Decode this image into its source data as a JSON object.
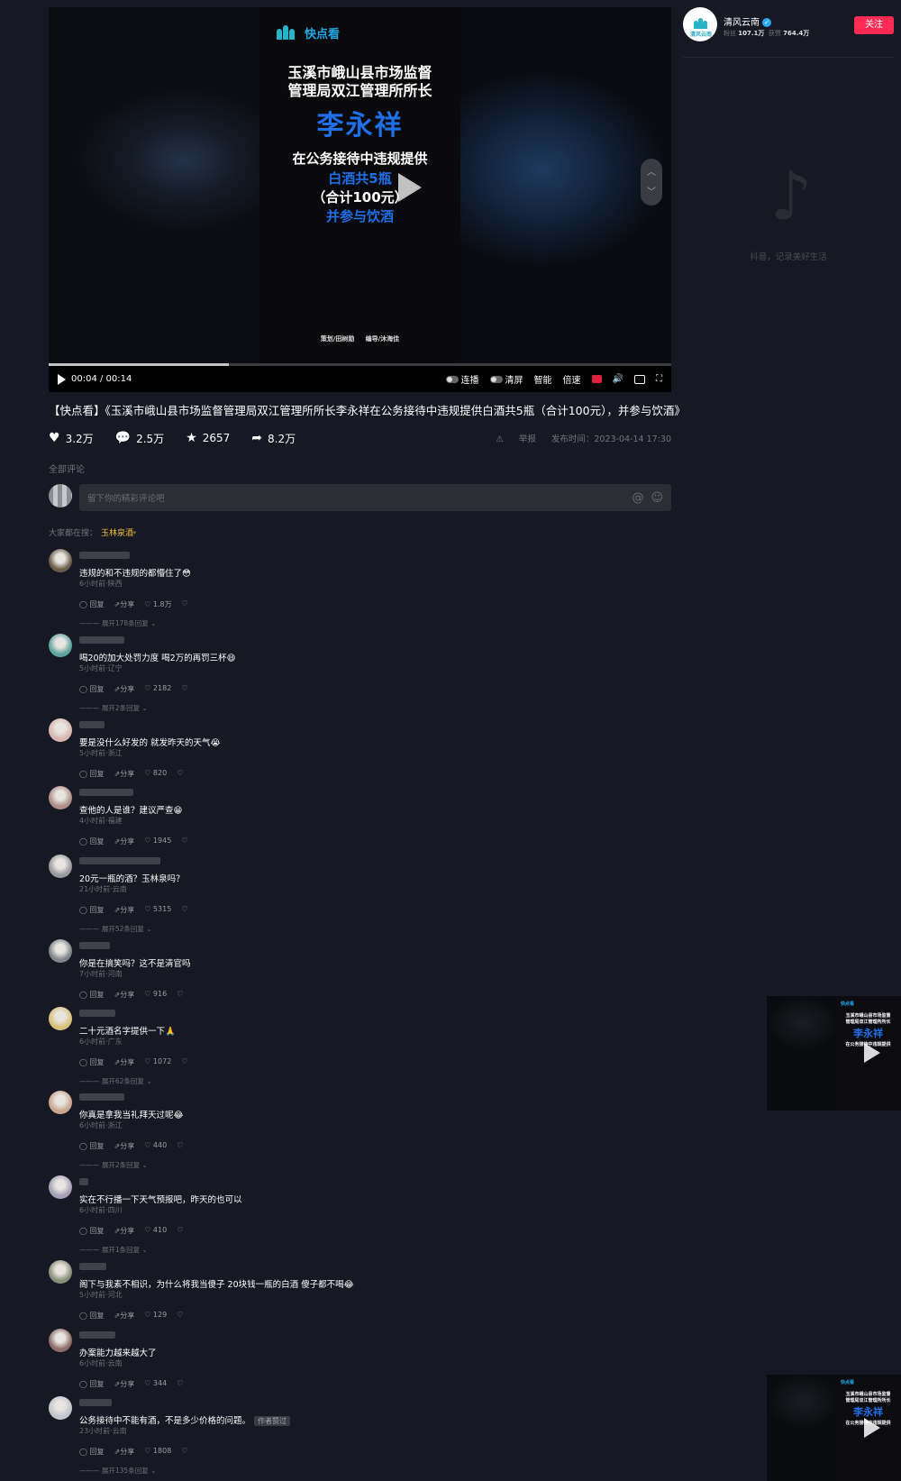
{
  "video": {
    "poster_brand_left": "清风云南",
    "poster_brand": "快点看",
    "poster_line1": "玉溪市峨山县市场监督",
    "poster_line2": "管理局双江管理所所长",
    "poster_name": "李永祥",
    "poster_line3": "在公务接待中违规提供",
    "poster_line4": "白酒共5瓶",
    "poster_line5": "（合计100元）",
    "poster_line6": "并参与饮酒",
    "poster_credit1": "策划/田树勋",
    "poster_credit2": "编导/沐海佳",
    "progress_fraction": 0.29,
    "time": "00:04 / 00:14",
    "ctl_autoplay": "连播",
    "ctl_clearscreen": "清屏",
    "ctl_smart": "智能",
    "ctl_speed": "倍速"
  },
  "title": "【快点看】《玉溪市峨山县市场监督管理局双江管理所所长李永祥在公务接待中违规提供白酒共5瓶（合计100元），并参与饮酒》",
  "stats": {
    "likes": "3.2万",
    "comments": "2.5万",
    "favorites": "2657",
    "shares": "8.2万",
    "report": "举报",
    "publish": "发布时间：2023-04-14 17:30"
  },
  "comments_header": "全部评论",
  "comment_placeholder": "留下你的精彩评论吧",
  "everyone_search": "大家都在搜：",
  "everyone_term": "玉林泉酒",
  "action_reply": "回复",
  "action_share": "分享",
  "comments": [
    {
      "text": "违规的和不违规的都懵住了😳",
      "loc": "6小时前·陕西",
      "likes": "1.8万",
      "expand": "展开178条回复"
    },
    {
      "text": "喝20的加大处罚力度 喝2万的再罚三杯😄",
      "loc": "5小时前·辽宁",
      "likes": "2182",
      "expand": "展开2条回复"
    },
    {
      "text": "要是没什么好发的 就发昨天的天气😭",
      "loc": "5小时前·浙江",
      "likes": "820",
      "expand": ""
    },
    {
      "text": "查他的人是谁？建议严查😁",
      "loc": "4小时前·福建",
      "likes": "1945",
      "expand": ""
    },
    {
      "text": "20元一瓶的酒？玉林泉吗？",
      "loc": "21小时前·云南",
      "likes": "5315",
      "expand": "展开52条回复"
    },
    {
      "text": "你是在搞笑吗？这不是清官吗",
      "loc": "7小时前·河南",
      "likes": "916",
      "expand": ""
    },
    {
      "text": "二十元酒名字提供一下🙏",
      "loc": "6小时前·广东",
      "likes": "1072",
      "expand": "展开62条回复"
    },
    {
      "text": "你真是拿我当礼拜天过呢😂",
      "loc": "6小时前·浙江",
      "likes": "440",
      "expand": "展开2条回复"
    },
    {
      "text": "实在不行播一下天气预报吧，昨天的也可以",
      "loc": "6小时前·四川",
      "likes": "410",
      "expand": "展开1条回复"
    },
    {
      "text": "阁下与我素不相识，为什么将我当傻子 20块钱一瓶的白酒 傻子都不喝😂",
      "loc": "5小时前·河北",
      "likes": "129",
      "expand": ""
    },
    {
      "text": "办案能力越来越大了",
      "loc": "6小时前·云南",
      "likes": "344",
      "expand": ""
    },
    {
      "text": "公务接待中不能有酒，不是多少价格的问题。",
      "tag": "作者赞过",
      "loc": "23小时前·云南",
      "likes": "1808",
      "expand": "展开135条回复"
    }
  ],
  "author": {
    "name": "清风云南",
    "fans_label": "粉丝",
    "fans": "107.1万",
    "likes_label": "获赞",
    "likes": "764.4万",
    "follow": "关注"
  },
  "sidebar_slogan": "抖音，记录美好生活",
  "thumb": {
    "brand": "快点看",
    "line1": "玉溪市峨山县市场监督",
    "line2": "管理局双江管理所所长",
    "name": "李永祥",
    "line3": "在公务接待中违规提供"
  }
}
